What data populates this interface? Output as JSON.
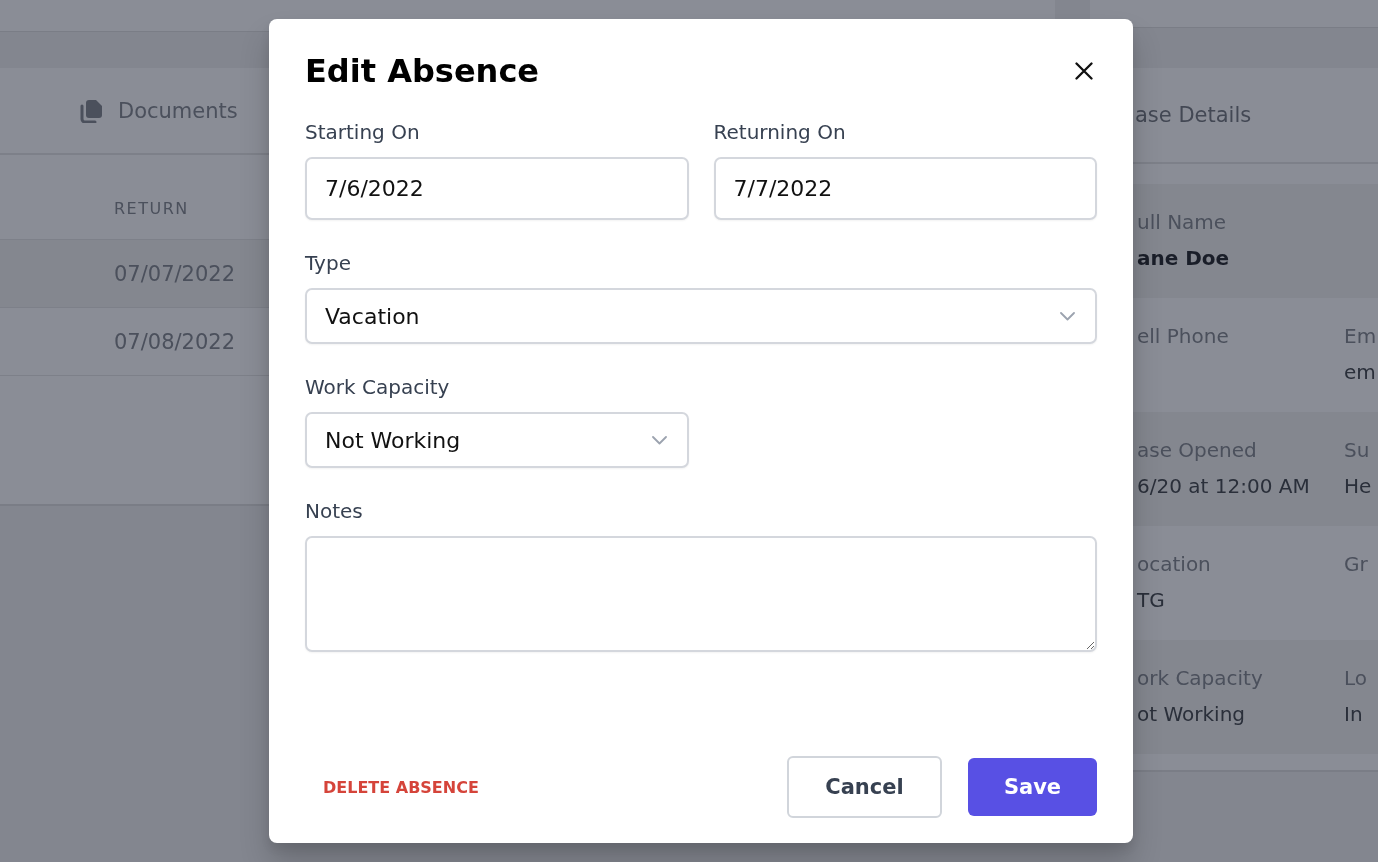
{
  "page": {
    "documents_panel": {
      "tab": {
        "label": "Documents"
      },
      "table": {
        "columns": [
          "RETURN"
        ],
        "rows": [
          [
            "07/07/2022"
          ],
          [
            "07/08/2022"
          ]
        ]
      }
    },
    "details_panel": {
      "title": "ase Details",
      "rows": [
        [
          {
            "label": "ull Name",
            "value": "ane Doe"
          }
        ],
        [
          {
            "label": "ell Phone"
          },
          {
            "label": "Em",
            "value": "em"
          }
        ],
        [
          {
            "label": "ase Opened",
            "value": "6/20 at 12:00 AM"
          },
          {
            "label": "Su",
            "value": "He"
          }
        ],
        [
          {
            "label": "ocation",
            "value": "TG"
          },
          {
            "label": "Gr"
          }
        ],
        [
          {
            "label": "ork Capacity",
            "value": "ot Working"
          },
          {
            "label": "Lo",
            "value": "In"
          }
        ]
      ]
    }
  },
  "dialog": {
    "title": "Edit Absence",
    "fields": [
      {
        "kind": "date",
        "label": "Starting On",
        "value": "7/6/2022"
      },
      {
        "kind": "date",
        "label": "Returning On",
        "value": "7/7/2022"
      },
      {
        "kind": "select",
        "label": "Type",
        "value": "Vacation"
      },
      {
        "kind": "select",
        "label": "Work Capacity",
        "value": "Not Working"
      },
      {
        "kind": "textarea",
        "label": "Notes"
      }
    ],
    "delete_action": "DELETE ABSENCE",
    "buttons": [
      {
        "label": "Cancel",
        "kind": "secondary"
      },
      {
        "label": "Save",
        "kind": "primary"
      }
    ]
  }
}
